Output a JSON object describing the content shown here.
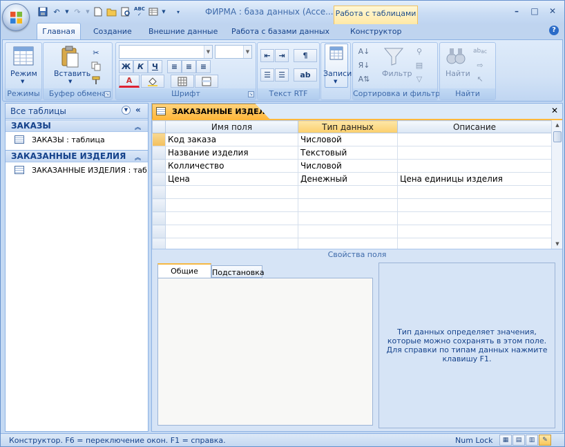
{
  "app": {
    "title": "ФИРМА : база данных (Acce...",
    "context_tab": "Работа с таблицами",
    "window_controls": [
      "minimize-icon",
      "maximize-icon",
      "close-icon"
    ]
  },
  "quick_access": [
    "save-icon",
    "undo-icon",
    "redo-icon",
    "new-icon",
    "open-icon",
    "print-preview-icon",
    "spelling-icon",
    "view-icon"
  ],
  "tabs": [
    {
      "label": "Главная",
      "active": true
    },
    {
      "label": "Создание",
      "active": false
    },
    {
      "label": "Внешние данные",
      "active": false
    },
    {
      "label": "Работа с базами данных",
      "active": false
    },
    {
      "label": "Конструктор",
      "active": false
    }
  ],
  "ribbon": {
    "groups": {
      "modes": {
        "label": "Режимы",
        "button": "Режим"
      },
      "clipboard": {
        "label": "Буфер обмена",
        "button": "Вставить"
      },
      "font": {
        "label": "Шрифт",
        "bold": "Ж",
        "italic": "К",
        "underline": "Ч",
        "font_color": "A"
      },
      "rtf": {
        "label": "Текст RTF"
      },
      "records": {
        "button": "Записи"
      },
      "sort_filter": {
        "label": "Сортировка и фильтр",
        "button": "Фильтр"
      },
      "find": {
        "label": "Найти",
        "button": "Найти"
      }
    }
  },
  "nav_pane": {
    "header": "Все таблицы",
    "groups": [
      {
        "title": "ЗАКАЗЫ",
        "items": [
          "ЗАКАЗЫ : таблица"
        ]
      },
      {
        "title": "ЗАКАЗАННЫЕ ИЗДЕЛИЯ",
        "items": [
          "ЗАКАЗАННЫЕ ИЗДЕЛИЯ : таб..."
        ]
      }
    ]
  },
  "document": {
    "tab_title": "ЗАКАЗАННЫЕ ИЗДЕЛИЯ",
    "columns": [
      "Имя поля",
      "Тип данных",
      "Описание"
    ],
    "rows": [
      [
        "Код заказа",
        "Числовой",
        ""
      ],
      [
        "Название изделия",
        "Текстовый",
        ""
      ],
      [
        "Колличество",
        "Числовой",
        ""
      ],
      [
        "Цена",
        "Денежный",
        "Цена единицы изделия"
      ],
      [
        "",
        "",
        ""
      ],
      [
        "",
        "",
        ""
      ],
      [
        "",
        "",
        ""
      ],
      [
        "",
        "",
        ""
      ],
      [
        "",
        "",
        ""
      ]
    ],
    "field_props_label": "Свойства поля",
    "prop_tabs": [
      "Общие",
      "Подстановка"
    ],
    "hint": "Тип данных определяет значения, которые можно сохранять в этом поле.  Для справки по типам данных нажмите клавишу F1."
  },
  "status_bar": {
    "text": "Конструктор.  F6 = переключение окон.  F1 = справка.",
    "numlock": "Num Lock"
  }
}
